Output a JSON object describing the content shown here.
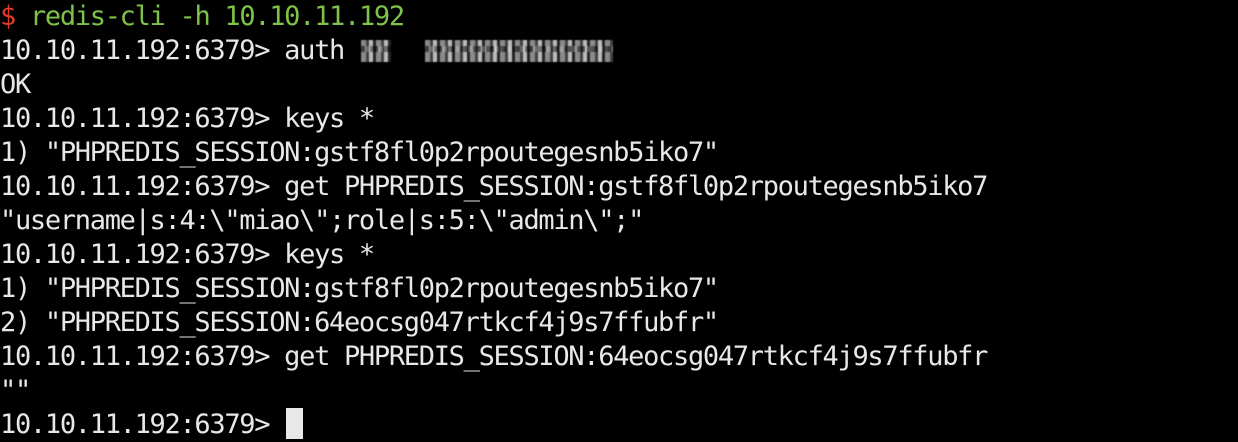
{
  "terminal": {
    "colors": {
      "background": "#000000",
      "foreground": "#e8e8e8",
      "prompt_dollar": "#e03b2a",
      "command_green": "#7fc24a"
    },
    "line1": {
      "dollar": "$",
      "command": "redis-cli -h 10.10.11.192"
    },
    "line2": {
      "prompt": "10.10.11.192:6379> ",
      "command": "auth ",
      "redacted": "auth credentials (pixelated)"
    },
    "line3": "OK",
    "line4": "10.10.11.192:6379> keys *",
    "line5": "1) \"PHPREDIS_SESSION:gstf8fl0p2rpoutegesnb5iko7\"",
    "line6": "10.10.11.192:6379> get PHPREDIS_SESSION:gstf8fl0p2rpoutegesnb5iko7",
    "line7": "\"username|s:4:\\\"miao\\\";role|s:5:\\\"admin\\\";\"",
    "line8": "10.10.11.192:6379> keys *",
    "line9": "1) \"PHPREDIS_SESSION:gstf8fl0p2rpoutegesnb5iko7\"",
    "line10": "2) \"PHPREDIS_SESSION:64eocsg047rtkcf4j9s7ffubfr\"",
    "line11": "10.10.11.192:6379> get PHPREDIS_SESSION:64eocsg047rtkcf4j9s7ffubfr",
    "line12": "\"\"",
    "line13": {
      "prompt": "10.10.11.192:6379> "
    }
  }
}
